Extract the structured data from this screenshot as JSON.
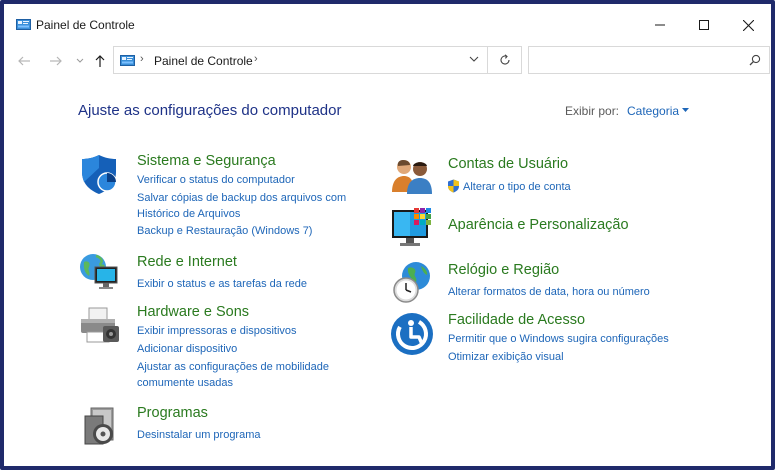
{
  "window": {
    "title": "Painel de Controle"
  },
  "address_bar": {
    "path": "Painel de Controle",
    "search_placeholder": ""
  },
  "main": {
    "heading": "Ajuste as configurações do computador",
    "view_by_label": "Exibir por:",
    "view_by_value": "Categoria"
  },
  "categories": {
    "system_security": {
      "title": "Sistema e Segurança",
      "links": [
        "Verificar o status do computador",
        "Salvar cópias de backup dos arquivos com",
        "Histórico de Arquivos",
        "Backup e Restauração (Windows 7)"
      ]
    },
    "network": {
      "title": "Rede e Internet",
      "links": [
        "Exibir o status e as tarefas da rede"
      ]
    },
    "hardware": {
      "title": "Hardware e Sons",
      "links": [
        "Exibir impressoras e dispositivos",
        "Adicionar dispositivo",
        "Ajustar as configurações de mobilidade",
        "comumente usadas"
      ]
    },
    "programs": {
      "title": "Programas",
      "links": [
        "Desinstalar um programa"
      ]
    },
    "user_accounts": {
      "title": "Contas de Usuário",
      "links": [
        "Alterar o tipo de conta"
      ]
    },
    "appearance": {
      "title": "Aparência e Personalização",
      "links": []
    },
    "clock_region": {
      "title": "Relógio e Região",
      "links": [
        "Alterar formatos de data, hora ou número"
      ]
    },
    "ease_access": {
      "title": "Facilidade de Acesso",
      "links": [
        "Permitir que o Windows sugira configurações",
        "Otimizar exibição visual"
      ]
    }
  },
  "colors": {
    "frame": "#1f2a6b",
    "heading": "#1e3287",
    "category_title": "#2a7a1f",
    "link": "#1e66b8"
  },
  "icons": {
    "app": "control-panel-icon",
    "back": "back-arrow-icon",
    "forward": "forward-arrow-icon",
    "recent": "recent-locations-icon",
    "up": "up-arrow-icon",
    "refresh": "refresh-icon",
    "search": "search-icon"
  }
}
